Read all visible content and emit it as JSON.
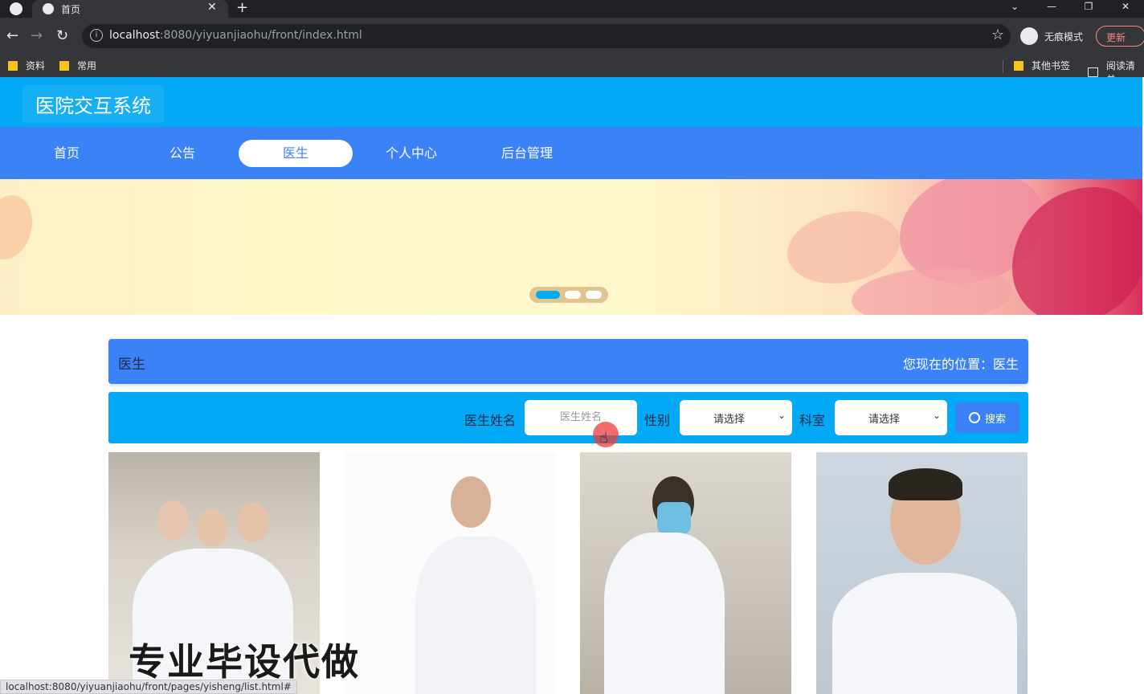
{
  "browser": {
    "tab_title": "首页",
    "url_host": "localhost",
    "url_rest": ":8080/yiyuanjiaohu/front/index.html",
    "incognito_label": "无痕模式",
    "update_label": "更新",
    "bookmarks": [
      "资料",
      "常用"
    ],
    "other_bookmarks": "其他书签",
    "reading_list": "阅读清单",
    "status_url": "localhost:8080/yiyuanjiaohu/front/pages/yisheng/list.html#"
  },
  "site": {
    "title": "医院交互系统",
    "nav": [
      {
        "label": "首页",
        "active": false
      },
      {
        "label": "公告",
        "active": false
      },
      {
        "label": "医生",
        "active": true
      },
      {
        "label": "个人中心",
        "active": false
      },
      {
        "label": "后台管理",
        "active": false
      }
    ]
  },
  "breadcrumb": {
    "title": "医生",
    "location": "您现在的位置：医生"
  },
  "search": {
    "name_label": "医生姓名",
    "name_placeholder": "医生姓名",
    "gender_label": "性别",
    "gender_value": "请选择",
    "dept_label": "科室",
    "dept_value": "请选择",
    "button_label": "搜索"
  },
  "overlay_text": "专业毕设代做",
  "colors": {
    "header": "#03a9f4",
    "navbar": "#3b82f6",
    "accent": "#3b82f6"
  }
}
